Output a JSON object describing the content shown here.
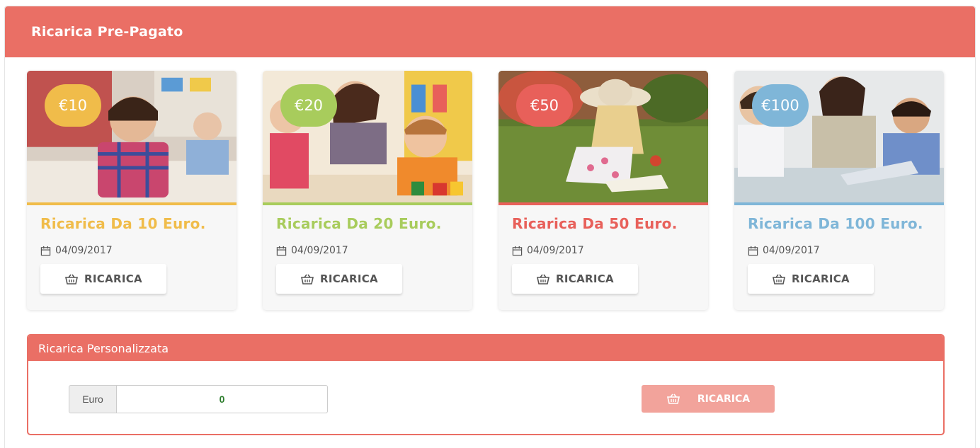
{
  "panel": {
    "title": "Ricarica Pre-Pagato"
  },
  "cards": [
    {
      "price": "€10",
      "title": "Ricarica Da 10 Euro.",
      "date": "04/09/2017",
      "button": "RICARICA",
      "color": "#f0bc4a"
    },
    {
      "price": "€20",
      "title": "Ricarica Da 20 Euro.",
      "date": "04/09/2017",
      "button": "RICARICA",
      "color": "#a8cc5c"
    },
    {
      "price": "€50",
      "title": "Ricarica Da 50 Euro.",
      "date": "04/09/2017",
      "button": "RICARICA",
      "color": "#e8605a"
    },
    {
      "price": "€100",
      "title": "Ricarica Da 100 Euro.",
      "date": "04/09/2017",
      "button": "RICARICA",
      "color": "#7fb6d8"
    }
  ],
  "custom": {
    "title": "Ricarica Personalizzata",
    "addon": "Euro",
    "amount": "0",
    "button": "RICARICA"
  },
  "icons": {
    "calendar": "calendar-icon",
    "basket": "basket-icon"
  },
  "colors": {
    "brand": "#ea6f65",
    "button_disabled": "#f2a39b"
  }
}
